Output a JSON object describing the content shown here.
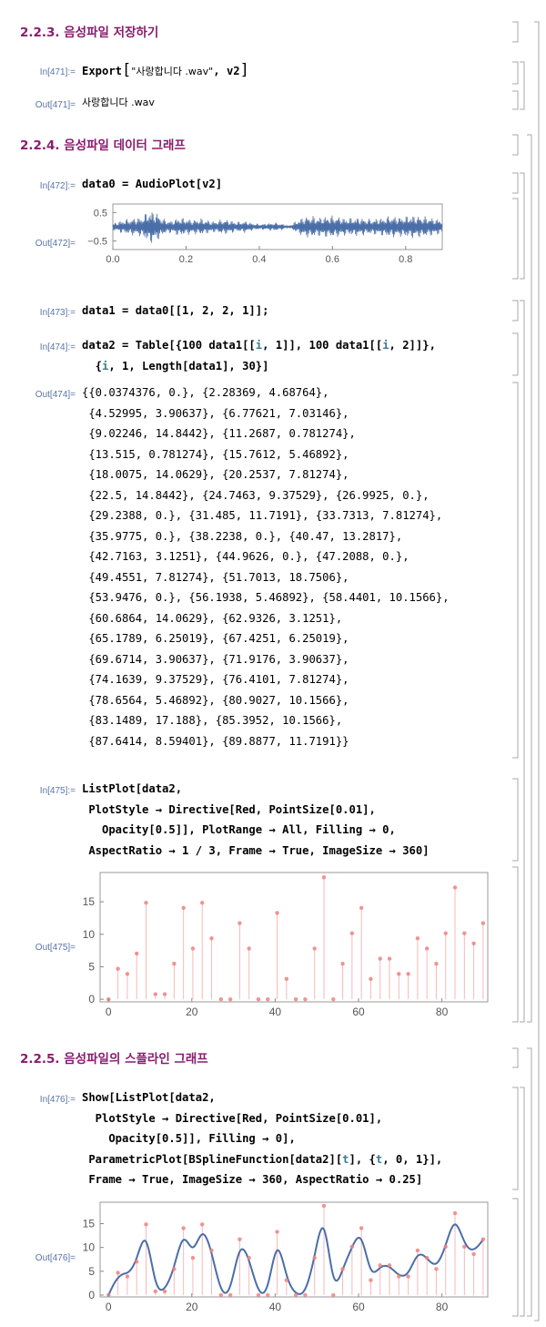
{
  "sections": {
    "s223": "2.2.3. 음성파일 저장하기",
    "s224": "2.2.4. 음성파일 데이터 그래프",
    "s225": "2.2.5. 음성파일의 스플라인 그래프"
  },
  "cells": {
    "in471": "In[471]:=",
    "out471": "Out[471]=",
    "in472": "In[472]:=",
    "out472": "Out[472]=",
    "in473": "In[473]:=",
    "in474": "In[474]:=",
    "out474": "Out[474]=",
    "in475": "In[475]:=",
    "out475": "Out[475]=",
    "in476": "In[476]:=",
    "out476": "Out[476]="
  },
  "code": {
    "export_fn": "Export",
    "export_str": "\"사랑합니다 .wav\"",
    "export_arg": "v2",
    "out471_text": "사랑합니다 .wav",
    "in472": "data0 = AudioPlot[v2]",
    "in473": "data1 = data0[[1, 2, 2, 1]];",
    "in474_l1a": "data2 = Table[{100 data1[[",
    "in474_i1": "i",
    "in474_l1b": ", 1]], 100 data1[[",
    "in474_i2": "i",
    "in474_l1c": ", 2]]},",
    "in474_l2a": "  {",
    "in474_i3": "i",
    "in474_l2b": ", 1, Length[data1], 30}]",
    "in475_l1": "ListPlot[data2,",
    "in475_l2": " PlotStyle → Directive[Red, PointSize[0.01],",
    "in475_l3": "   Opacity[0.5]], PlotRange → All, Filling → 0,",
    "in475_l4": " AspectRatio → 1 / 3, Frame → True, ImageSize → 360]",
    "in476_l1": "Show[ListPlot[data2,",
    "in476_l2": "  PlotStyle → Directive[Red, PointSize[0.01],",
    "in476_l3": "    Opacity[0.5]], Filling → 0],",
    "in476_l4a": " ParametricPlot[BSplineFunction[data2][",
    "in476_t1": "t",
    "in476_l4b": "], {",
    "in476_t2": "t",
    "in476_l4c": ", 0, 1}],",
    "in476_l5": " Frame → True, ImageSize → 360, AspectRatio → 0.25]"
  },
  "out474_lines": [
    "{{0.0374376, 0.}, {2.28369, 4.68764},",
    " {4.52995, 3.90637}, {6.77621, 7.03146},",
    " {9.02246, 14.8442}, {11.2687, 0.781274},",
    " {13.515, 0.781274}, {15.7612, 5.46892},",
    " {18.0075, 14.0629}, {20.2537, 7.81274},",
    " {22.5, 14.8442}, {24.7463, 9.37529}, {26.9925, 0.},",
    " {29.2388, 0.}, {31.485, 11.7191}, {33.7313, 7.81274},",
    " {35.9775, 0.}, {38.2238, 0.}, {40.47, 13.2817},",
    " {42.7163, 3.1251}, {44.9626, 0.}, {47.2088, 0.},",
    " {49.4551, 7.81274}, {51.7013, 18.7506},",
    " {53.9476, 0.}, {56.1938, 5.46892}, {58.4401, 10.1566},",
    " {60.6864, 14.0629}, {62.9326, 3.1251},",
    " {65.1789, 6.25019}, {67.4251, 6.25019},",
    " {69.6714, 3.90637}, {71.9176, 3.90637},",
    " {74.1639, 9.37529}, {76.4101, 7.81274},",
    " {78.6564, 5.46892}, {80.9027, 10.1566},",
    " {83.1489, 17.188}, {85.3952, 10.1566},",
    " {87.6414, 8.59401}, {89.8877, 11.7191}}"
  ],
  "chart_data": [
    {
      "type": "line",
      "x_ticks": [
        "0.0",
        "0.2",
        "0.4",
        "0.6",
        "0.8"
      ],
      "y_ticks": [
        "0.5",
        "-0.5"
      ],
      "xlim": [
        0,
        0.9
      ],
      "ylim": [
        -0.8,
        0.8
      ],
      "color": "#4a6ea8",
      "envelope": [
        {
          "x": 0.0,
          "a": 0.12
        },
        {
          "x": 0.02,
          "a": 0.22
        },
        {
          "x": 0.04,
          "a": 0.28
        },
        {
          "x": 0.06,
          "a": 0.32
        },
        {
          "x": 0.08,
          "a": 0.36
        },
        {
          "x": 0.1,
          "a": 0.62
        },
        {
          "x": 0.12,
          "a": 0.52
        },
        {
          "x": 0.14,
          "a": 0.28
        },
        {
          "x": 0.16,
          "a": 0.22
        },
        {
          "x": 0.18,
          "a": 0.34
        },
        {
          "x": 0.2,
          "a": 0.3
        },
        {
          "x": 0.22,
          "a": 0.26
        },
        {
          "x": 0.24,
          "a": 0.3
        },
        {
          "x": 0.26,
          "a": 0.24
        },
        {
          "x": 0.28,
          "a": 0.2
        },
        {
          "x": 0.3,
          "a": 0.28
        },
        {
          "x": 0.32,
          "a": 0.24
        },
        {
          "x": 0.34,
          "a": 0.18
        },
        {
          "x": 0.36,
          "a": 0.22
        },
        {
          "x": 0.38,
          "a": 0.14
        },
        {
          "x": 0.4,
          "a": 0.1
        },
        {
          "x": 0.42,
          "a": 0.12
        },
        {
          "x": 0.44,
          "a": 0.16
        },
        {
          "x": 0.46,
          "a": 0.12
        },
        {
          "x": 0.48,
          "a": 0.04
        },
        {
          "x": 0.5,
          "a": 0.2
        },
        {
          "x": 0.52,
          "a": 0.36
        },
        {
          "x": 0.54,
          "a": 0.4
        },
        {
          "x": 0.56,
          "a": 0.34
        },
        {
          "x": 0.58,
          "a": 0.38
        },
        {
          "x": 0.6,
          "a": 0.4
        },
        {
          "x": 0.62,
          "a": 0.36
        },
        {
          "x": 0.64,
          "a": 0.3
        },
        {
          "x": 0.66,
          "a": 0.34
        },
        {
          "x": 0.68,
          "a": 0.32
        },
        {
          "x": 0.7,
          "a": 0.28
        },
        {
          "x": 0.72,
          "a": 0.3
        },
        {
          "x": 0.74,
          "a": 0.34
        },
        {
          "x": 0.76,
          "a": 0.4
        },
        {
          "x": 0.78,
          "a": 0.36
        },
        {
          "x": 0.8,
          "a": 0.38
        },
        {
          "x": 0.82,
          "a": 0.42
        },
        {
          "x": 0.84,
          "a": 0.38
        },
        {
          "x": 0.86,
          "a": 0.36
        },
        {
          "x": 0.88,
          "a": 0.3
        },
        {
          "x": 0.9,
          "a": 0.26
        }
      ]
    },
    {
      "type": "scatter",
      "filling": true,
      "color": "#f08080",
      "x_ticks": [
        "0",
        "20",
        "40",
        "60",
        "80"
      ],
      "y_ticks": [
        "0",
        "5",
        "10",
        "15"
      ],
      "xlim": [
        -2,
        91
      ],
      "ylim": [
        -0.4,
        19.5
      ],
      "x": [
        0.0374376,
        2.28369,
        4.52995,
        6.77621,
        9.02246,
        11.2687,
        13.515,
        15.7612,
        18.0075,
        20.2537,
        22.5,
        24.7463,
        26.9925,
        29.2388,
        31.485,
        33.7313,
        35.9775,
        38.2238,
        40.47,
        42.7163,
        44.9626,
        47.2088,
        49.4551,
        51.7013,
        53.9476,
        56.1938,
        58.4401,
        60.6864,
        62.9326,
        65.1789,
        67.4251,
        69.6714,
        71.9176,
        74.1639,
        76.4101,
        78.6564,
        80.9027,
        83.1489,
        85.3952,
        87.6414,
        89.8877
      ],
      "y": [
        0,
        4.68764,
        3.90637,
        7.03146,
        14.8442,
        0.781274,
        0.781274,
        5.46892,
        14.0629,
        7.81274,
        14.8442,
        9.37529,
        0,
        0,
        11.7191,
        7.81274,
        0,
        0,
        13.2817,
        3.1251,
        0,
        0,
        7.81274,
        18.7506,
        0,
        5.46892,
        10.1566,
        14.0629,
        3.1251,
        6.25019,
        6.25019,
        3.90637,
        3.90637,
        9.37529,
        7.81274,
        5.46892,
        10.1566,
        17.188,
        10.1566,
        8.59401,
        11.7191
      ]
    },
    {
      "type": "scatter",
      "filling": true,
      "spline": true,
      "color": "#f08080",
      "spline_color": "#4a6ea8",
      "x_ticks": [
        "0",
        "20",
        "40",
        "60",
        "80"
      ],
      "y_ticks": [
        "0",
        "5",
        "10",
        "15"
      ],
      "xlim": [
        -2,
        91
      ],
      "ylim": [
        -0.4,
        19.5
      ]
    }
  ]
}
